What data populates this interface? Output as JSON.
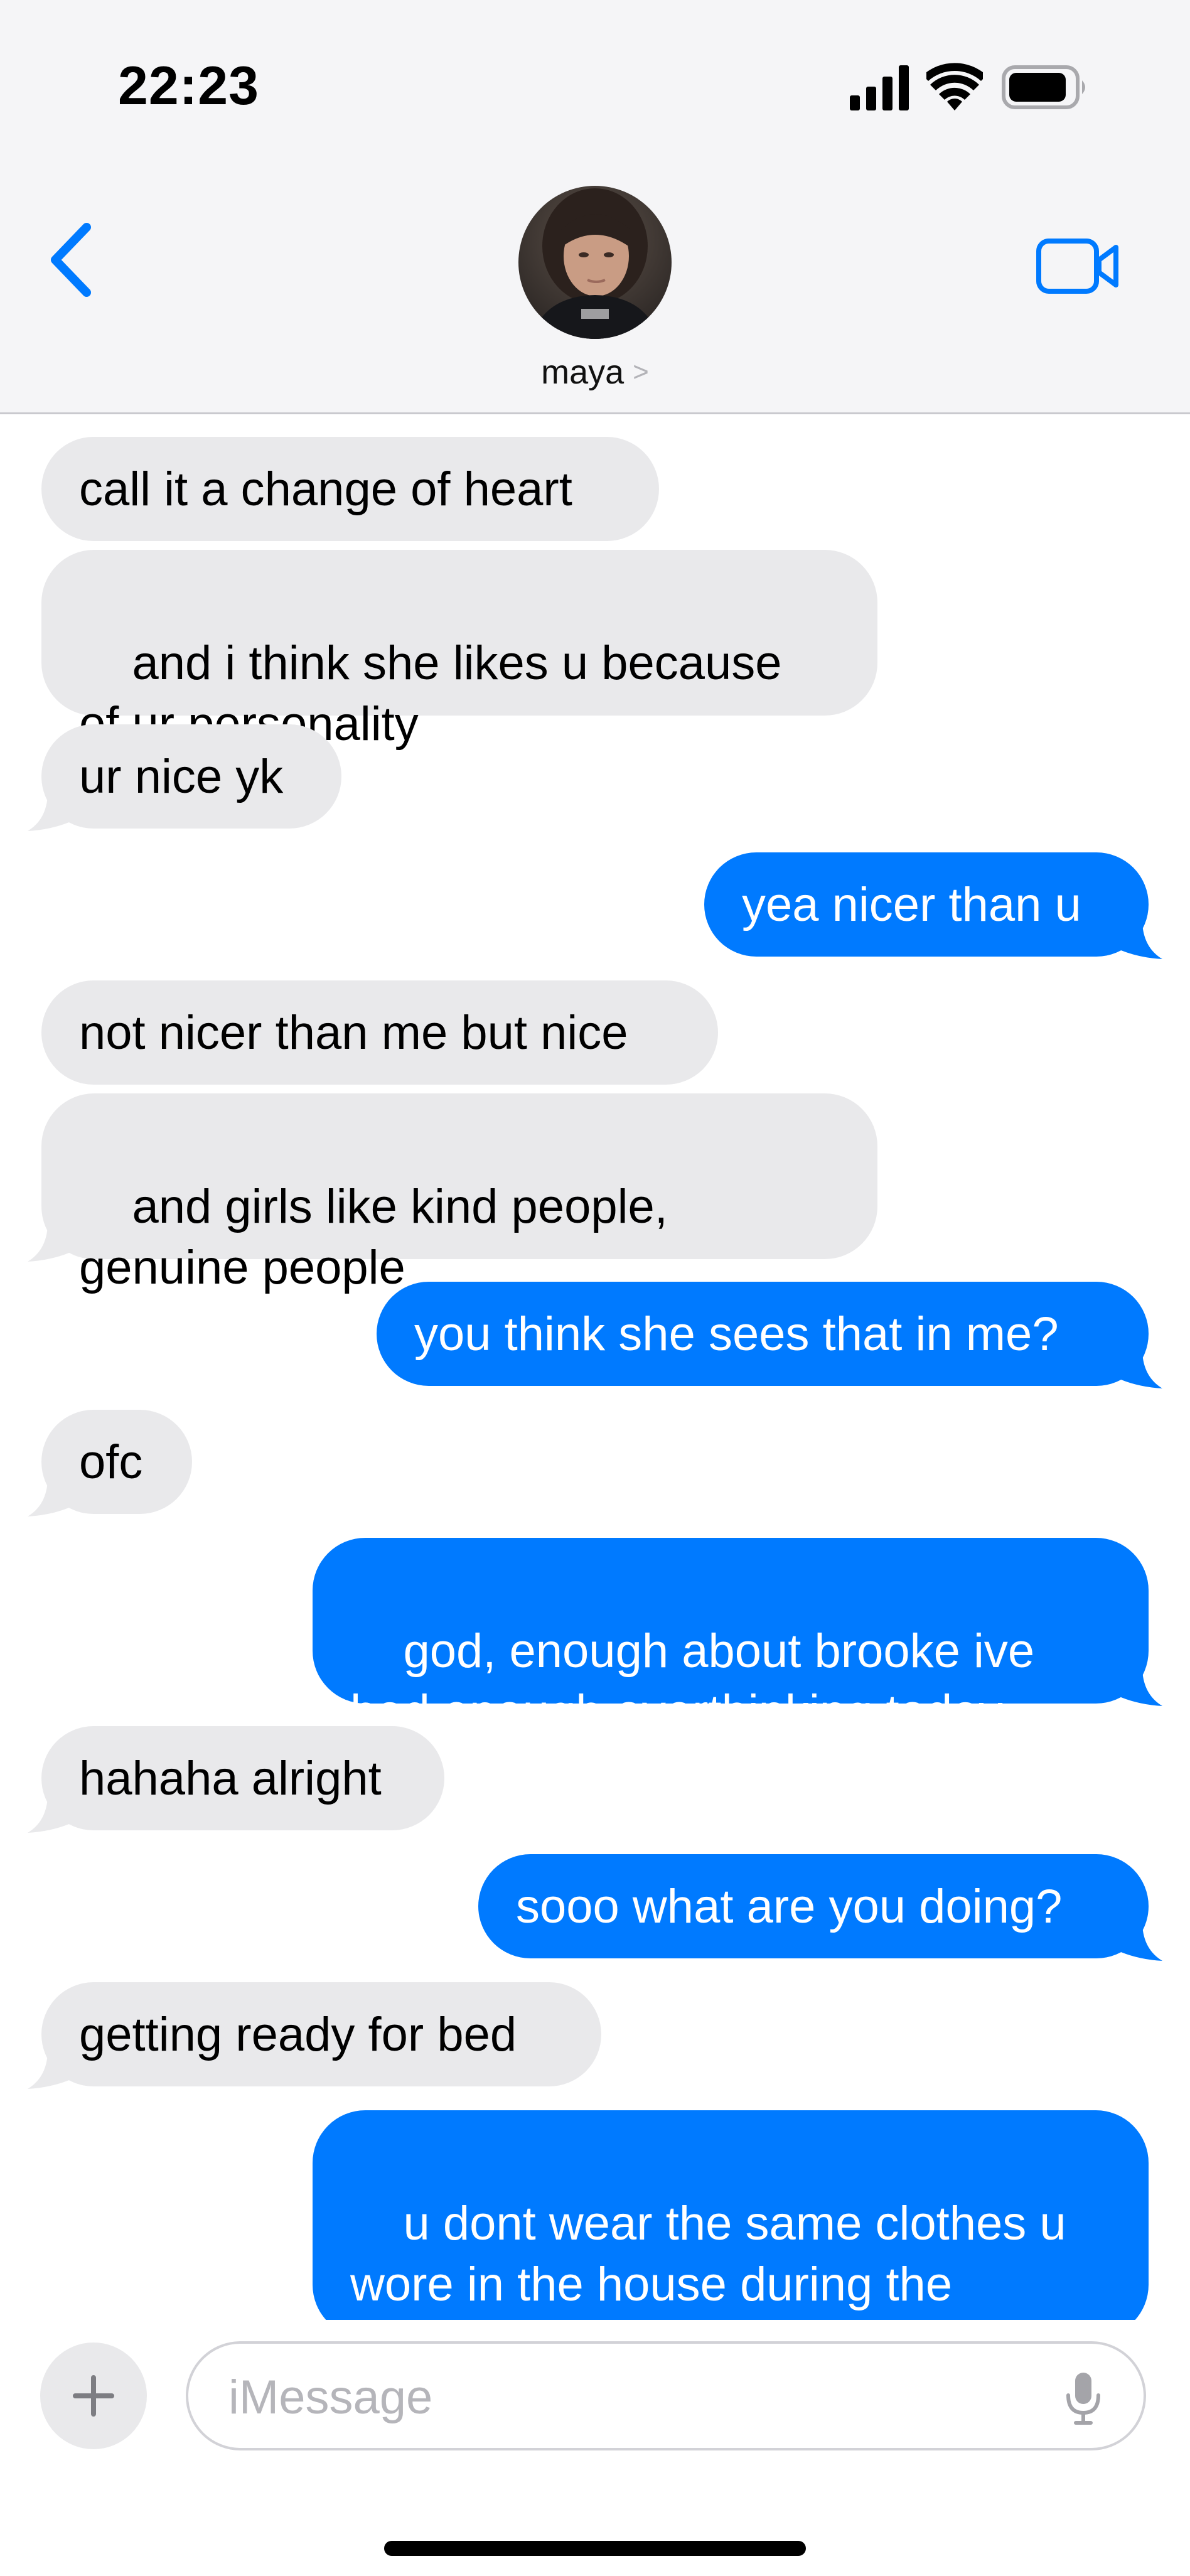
{
  "status_bar": {
    "time": "22:23",
    "icons": [
      "cellular-signal-icon",
      "wifi-icon",
      "battery-icon"
    ]
  },
  "nav": {
    "back_icon": "chevron-left-icon",
    "contact_name": "maya",
    "contact_chevron": ">",
    "video_icon": "video-camera-icon"
  },
  "messages": [
    {
      "from": "them",
      "text": "call it a change of heart"
    },
    {
      "from": "them",
      "text": "and i think she likes u because\nof ur personality"
    },
    {
      "from": "them",
      "text": "ur nice yk"
    },
    {
      "from": "me",
      "text": "yea nicer than u"
    },
    {
      "from": "them",
      "text": "not nicer than me but nice"
    },
    {
      "from": "them",
      "text": "and girls like kind people,\ngenuine people"
    },
    {
      "from": "me",
      "text": "you think she sees that in me?"
    },
    {
      "from": "them",
      "text": "ofc"
    },
    {
      "from": "me",
      "text": "god, enough about brooke ive\nhad enough overthinking today"
    },
    {
      "from": "them",
      "text": "hahaha alright"
    },
    {
      "from": "me",
      "text": "sooo what are you doing?"
    },
    {
      "from": "them",
      "text": "getting ready for bed"
    },
    {
      "from": "me",
      "text": "u dont wear the same clothes u\nwore in the house during the\nday?"
    }
  ],
  "composer": {
    "plus_icon": "plus-icon",
    "placeholder": "iMessage",
    "mic_icon": "microphone-icon"
  },
  "colors": {
    "outgoing_bubble": "#007aff",
    "incoming_bubble": "#e9e9eb",
    "accent": "#007aff",
    "header_background": "#f5f5f7"
  }
}
